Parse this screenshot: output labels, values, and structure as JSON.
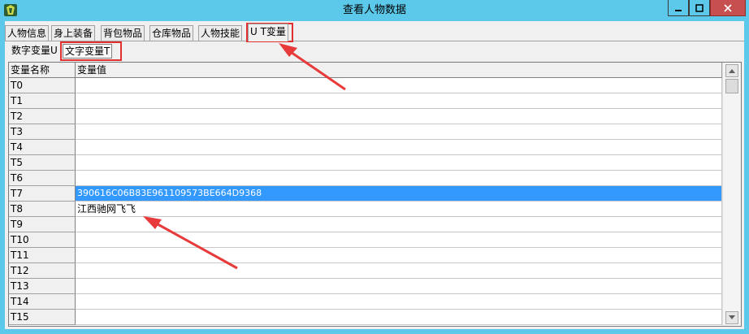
{
  "window": {
    "title": "查看人物数据"
  },
  "tabs": [
    {
      "label": "人物信息"
    },
    {
      "label": "身上装备"
    },
    {
      "label": "背包物品"
    },
    {
      "label": "仓库物品"
    },
    {
      "label": "人物技能"
    },
    {
      "label": "U T变量"
    }
  ],
  "active_tab": "U T变量",
  "subtabs": [
    {
      "label": "数字变量U"
    },
    {
      "label": "文字变量T"
    }
  ],
  "active_subtab": "文字变量T",
  "grid": {
    "columns": [
      "变量名称",
      "变量值"
    ],
    "rows": [
      {
        "name": "T0",
        "value": ""
      },
      {
        "name": "T1",
        "value": ""
      },
      {
        "name": "T2",
        "value": ""
      },
      {
        "name": "T3",
        "value": ""
      },
      {
        "name": "T4",
        "value": ""
      },
      {
        "name": "T5",
        "value": ""
      },
      {
        "name": "T6",
        "value": ""
      },
      {
        "name": "T7",
        "value": "390616C06B83E961109573BE664D9368"
      },
      {
        "name": "T8",
        "value": "江西驰网飞飞"
      },
      {
        "name": "T9",
        "value": ""
      },
      {
        "name": "T10",
        "value": ""
      },
      {
        "name": "T11",
        "value": ""
      },
      {
        "name": "T12",
        "value": ""
      },
      {
        "name": "T13",
        "value": ""
      },
      {
        "name": "T14",
        "value": ""
      },
      {
        "name": "T15",
        "value": ""
      }
    ],
    "selected_row": "T7"
  },
  "colors": {
    "titlebar": "#5cc8ea",
    "close_button": "#c74f4f",
    "selection": "#3399ff",
    "annotation": "#e03030"
  },
  "icons": {
    "app": "game-app-icon",
    "minimize": "minimize-icon",
    "maximize": "maximize-icon",
    "close": "close-icon",
    "scroll_up": "scroll-up-arrow-icon",
    "scroll_down": "scroll-down-arrow-icon"
  }
}
